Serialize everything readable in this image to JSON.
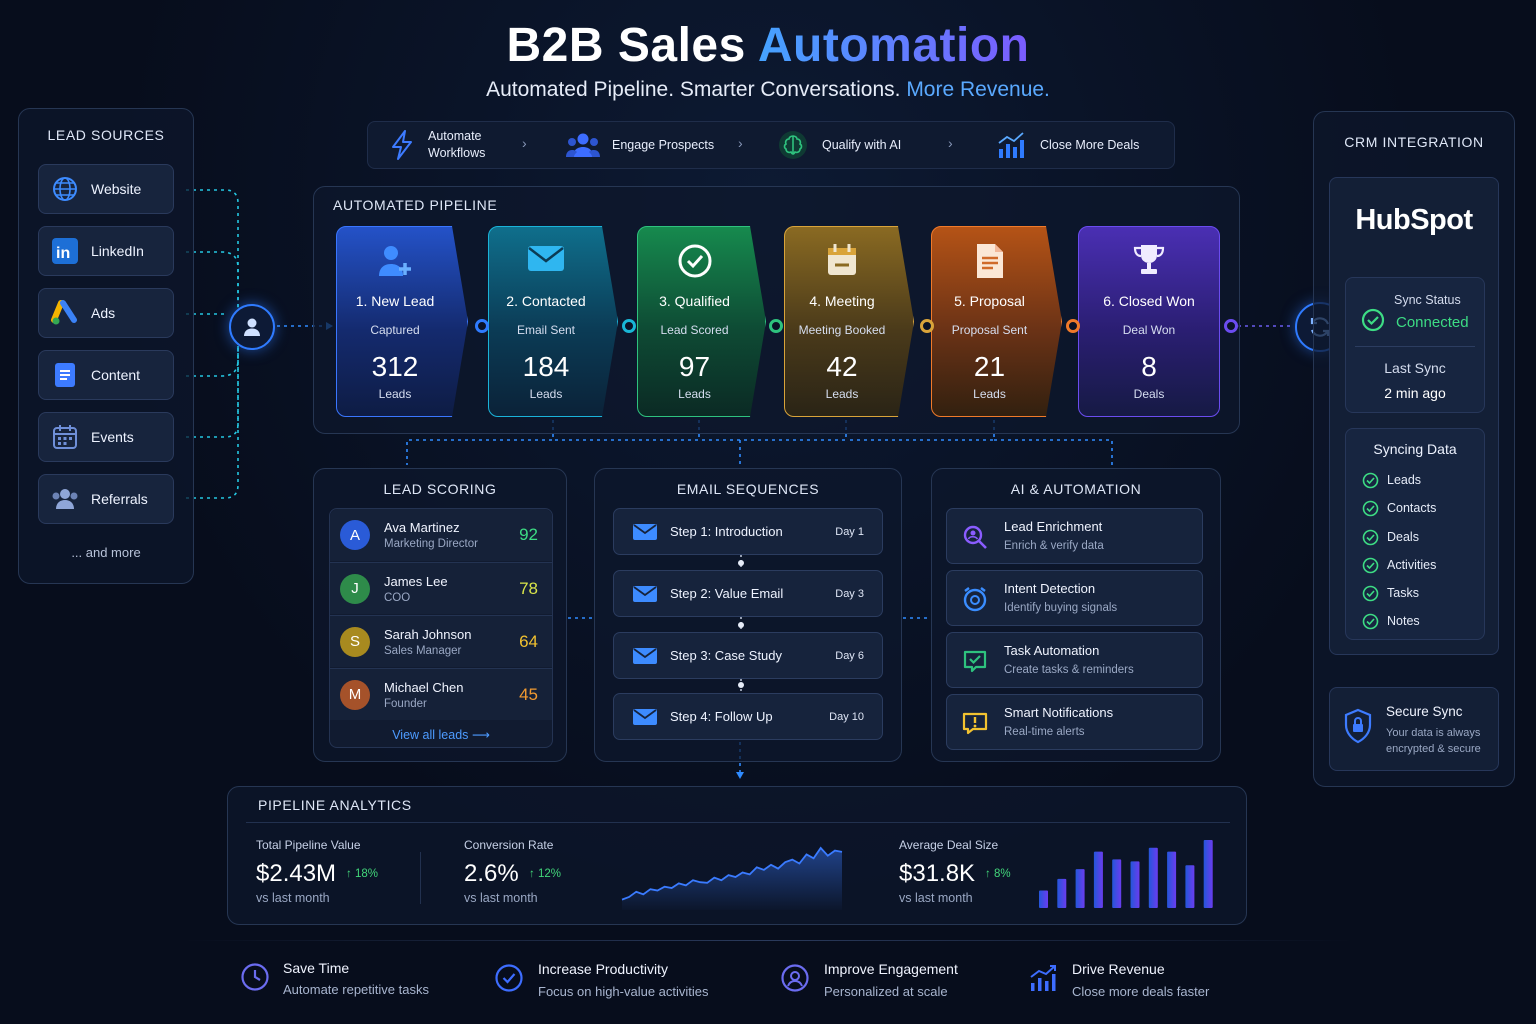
{
  "header": {
    "title_plain": "B2B Sales",
    "title_accent": "Automation",
    "tagline_plain": "Automated Pipeline. Smarter Conversations.",
    "tagline_accent": "More Revenue."
  },
  "lead_sources": {
    "title": "LEAD SOURCES",
    "items": [
      {
        "label": "Website",
        "icon": "globe-icon"
      },
      {
        "label": "LinkedIn",
        "icon": "linkedin-icon"
      },
      {
        "label": "Ads",
        "icon": "google-ads-icon"
      },
      {
        "label": "Content",
        "icon": "document-icon"
      },
      {
        "label": "Events",
        "icon": "calendar-icon"
      },
      {
        "label": "Referrals",
        "icon": "people-icon"
      }
    ],
    "more": "... and more"
  },
  "top_steps": [
    {
      "label": "Automate\nWorkflows",
      "icon": "lightning-icon"
    },
    {
      "label": "Engage Prospects",
      "icon": "people-icon"
    },
    {
      "label": "Qualify with AI",
      "icon": "brain-icon"
    },
    {
      "label": "Close More Deals",
      "icon": "bar-chart-icon"
    }
  ],
  "pipeline": {
    "title": "AUTOMATED PIPELINE",
    "stages": [
      {
        "title": "1. New Lead",
        "subtitle": "Captured",
        "count": "312",
        "unit": "Leads",
        "color": "#2f7bff"
      },
      {
        "title": "2. Contacted",
        "subtitle": "Email Sent",
        "count": "184",
        "unit": "Leads",
        "color": "#19b6d6"
      },
      {
        "title": "3. Qualified",
        "subtitle": "Lead Scored",
        "count": "97",
        "unit": "Leads",
        "color": "#2ec27e"
      },
      {
        "title": "4. Meeting",
        "subtitle": "Meeting Booked",
        "count": "42",
        "unit": "Leads",
        "color": "#d9a43a"
      },
      {
        "title": "5. Proposal",
        "subtitle": "Proposal Sent",
        "count": "21",
        "unit": "Leads",
        "color": "#f07a2a"
      },
      {
        "title": "6. Closed Won",
        "subtitle": "Deal Won",
        "count": "8",
        "unit": "Deals",
        "color": "#6b4cf0"
      }
    ]
  },
  "lead_scoring": {
    "title": "LEAD SCORING",
    "leads": [
      {
        "initial": "A",
        "name": "Ava Martinez",
        "role": "Marketing Director",
        "score": "92",
        "avatar_color": "#2a5bd7",
        "score_color": "#3ddc84"
      },
      {
        "initial": "J",
        "name": "James Lee",
        "role": "COO",
        "score": "78",
        "avatar_color": "#2e8b4a",
        "score_color": "#d9e54a"
      },
      {
        "initial": "S",
        "name": "Sarah Johnson",
        "role": "Sales Manager",
        "score": "64",
        "avatar_color": "#a88a1f",
        "score_color": "#f2c230"
      },
      {
        "initial": "M",
        "name": "Michael Chen",
        "role": "Founder",
        "score": "45",
        "avatar_color": "#a5522a",
        "score_color": "#f29a30"
      }
    ],
    "view_all": "View all leads"
  },
  "email_sequences": {
    "title": "EMAIL SEQUENCES",
    "steps": [
      {
        "label": "Step 1: Introduction",
        "day": "Day 1"
      },
      {
        "label": "Step 2: Value Email",
        "day": "Day 3"
      },
      {
        "label": "Step 3: Case Study",
        "day": "Day 6"
      },
      {
        "label": "Step 4: Follow Up",
        "day": "Day 10"
      }
    ]
  },
  "ai_automation": {
    "title": "AI & AUTOMATION",
    "items": [
      {
        "title": "Lead Enrichment",
        "desc": "Enrich & verify data",
        "icon": "enrich-search-icon",
        "color": "#8a5cff"
      },
      {
        "title": "Intent Detection",
        "desc": "Identify buying signals",
        "icon": "alarm-target-icon",
        "color": "#3a8dff"
      },
      {
        "title": "Task Automation",
        "desc": "Create tasks & reminders",
        "icon": "task-check-icon",
        "color": "#2ec27e"
      },
      {
        "title": "Smart Notifications",
        "desc": "Real-time alerts",
        "icon": "chat-alert-icon",
        "color": "#f2c230"
      }
    ]
  },
  "crm": {
    "title": "CRM INTEGRATION",
    "brand": "HubSpot",
    "sync_status_label": "Sync Status",
    "sync_status": "Connected",
    "last_sync_label": "Last Sync",
    "last_sync": "2 min ago",
    "syncing_title": "Syncing Data",
    "syncing_items": [
      "Leads",
      "Contacts",
      "Deals",
      "Activities",
      "Tasks",
      "Notes"
    ],
    "secure_title": "Secure Sync",
    "secure_desc_1": "Your data is always",
    "secure_desc_2": "encrypted & secure"
  },
  "analytics": {
    "title": "PIPELINE ANALYTICS",
    "metrics": [
      {
        "label": "Total Pipeline Value",
        "value": "$2.43M",
        "change": "↑ 18%",
        "sub": "vs last month"
      },
      {
        "label": "Conversion Rate",
        "value": "2.6%",
        "change": "↑ 12%",
        "sub": "vs last month"
      },
      {
        "label": "Average Deal Size",
        "value": "$31.8K",
        "change": "↑ 8%",
        "sub": "vs last month"
      }
    ],
    "colors": {
      "up": "#42d67a",
      "line": "#3a7bff",
      "bar_start": "#2456d9",
      "bar_end": "#6a3df0"
    }
  },
  "chart_data": [
    {
      "type": "area",
      "x": [
        1,
        2,
        3,
        4,
        5,
        6,
        7,
        8,
        9,
        10,
        11,
        12,
        13,
        14,
        15,
        16,
        17,
        18,
        19,
        20,
        21,
        22,
        23,
        24,
        25,
        26,
        27,
        28,
        29,
        30,
        31,
        32
      ],
      "values": [
        10,
        14,
        22,
        18,
        26,
        24,
        30,
        28,
        35,
        32,
        40,
        37,
        36,
        44,
        40,
        48,
        45,
        52,
        49,
        60,
        56,
        64,
        58,
        68,
        72,
        66,
        80,
        74,
        90,
        78,
        86,
        84
      ],
      "title": "",
      "xlabel": "",
      "ylabel": "",
      "grid": false
    },
    {
      "type": "bar",
      "categories": [
        "1",
        "2",
        "3",
        "4",
        "5",
        "6",
        "7",
        "8",
        "9",
        "10"
      ],
      "values": [
        18,
        30,
        40,
        58,
        50,
        48,
        62,
        58,
        44,
        70
      ],
      "title": "",
      "xlabel": "",
      "ylabel": "",
      "grid": false
    }
  ],
  "benefits": [
    {
      "title": "Save Time",
      "desc": "Automate repetitive tasks",
      "icon": "clock-icon"
    },
    {
      "title": "Increase Productivity",
      "desc": "Focus on high-value activities",
      "icon": "check-circle-icon"
    },
    {
      "title": "Improve Engagement",
      "desc": "Personalized at scale",
      "icon": "engagement-icon"
    },
    {
      "title": "Drive Revenue",
      "desc": "Close more deals faster",
      "icon": "growth-chart-icon"
    }
  ]
}
